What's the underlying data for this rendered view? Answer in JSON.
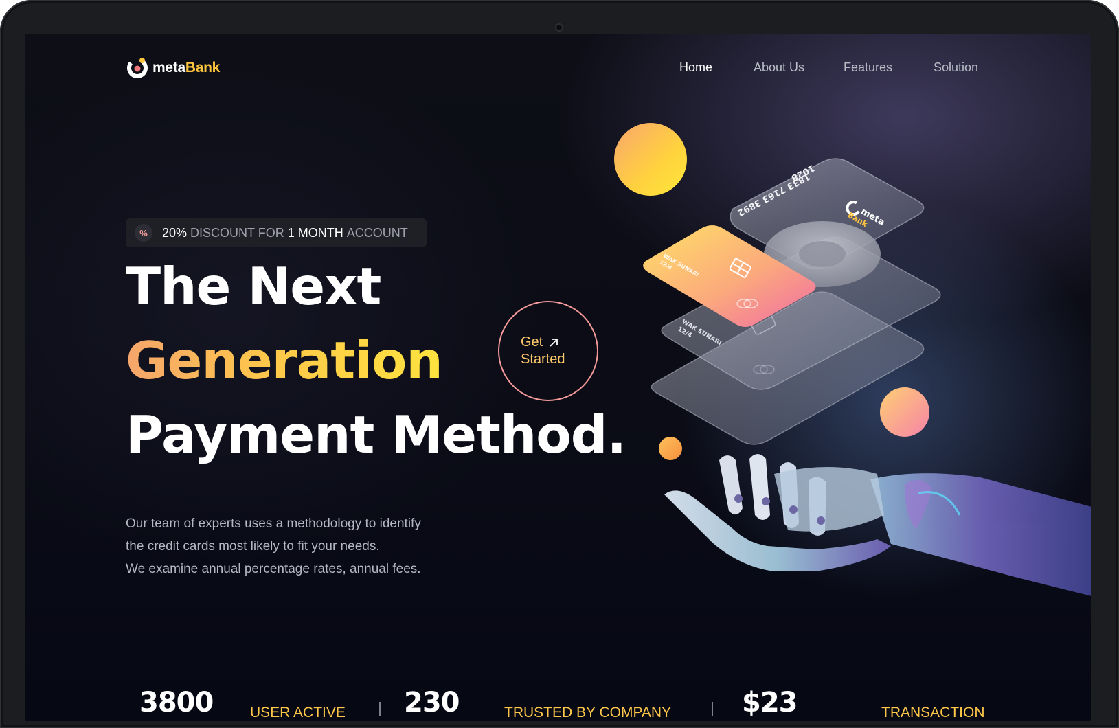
{
  "brand": {
    "name_prefix": "meta",
    "name_suffix": "Bank",
    "accent": "#ffc53d",
    "icon": "logo-mark-icon"
  },
  "nav": {
    "items": [
      {
        "label": "Home",
        "active": true
      },
      {
        "label": "About Us",
        "active": false
      },
      {
        "label": "Features",
        "active": false
      },
      {
        "label": "Solution",
        "active": false
      }
    ]
  },
  "badge": {
    "icon": "percent-icon",
    "icon_glyph": "%",
    "percent": "20%",
    "text1": "DISCOUNT FOR",
    "highlight": "1 MONTH",
    "text2": "ACCOUNT"
  },
  "hero": {
    "line1": "The Next",
    "line2": "Generation",
    "line3": "Payment Method.",
    "cta_line1": "Get",
    "cta_line2": "Started",
    "description": [
      "Our team of experts uses a methodology to identify",
      "the credit cards most likely to fit your needs.",
      "We examine annual percentage rates, annual fees."
    ]
  },
  "card": {
    "number": "1833 7163 3892",
    "number_end": "1028",
    "brand_top": "meta",
    "brand_bottom": "Bank",
    "holder": "WAK SUNARI",
    "expiry": "12/4",
    "holder2": "WAK SUNARI",
    "expiry2": "12/4"
  },
  "stats": [
    {
      "value": "3800",
      "label": "USER ACTIVE"
    },
    {
      "value": "230",
      "label": "TRUSTED BY COMPANY"
    },
    {
      "value": "$23",
      "label": "TRANSACTION"
    }
  ],
  "colors": {
    "background": "#0b0c16",
    "accent_yellow": "#ffc84a",
    "accent_pink": "#f59a9a",
    "text_muted": "#b5b8c2"
  }
}
